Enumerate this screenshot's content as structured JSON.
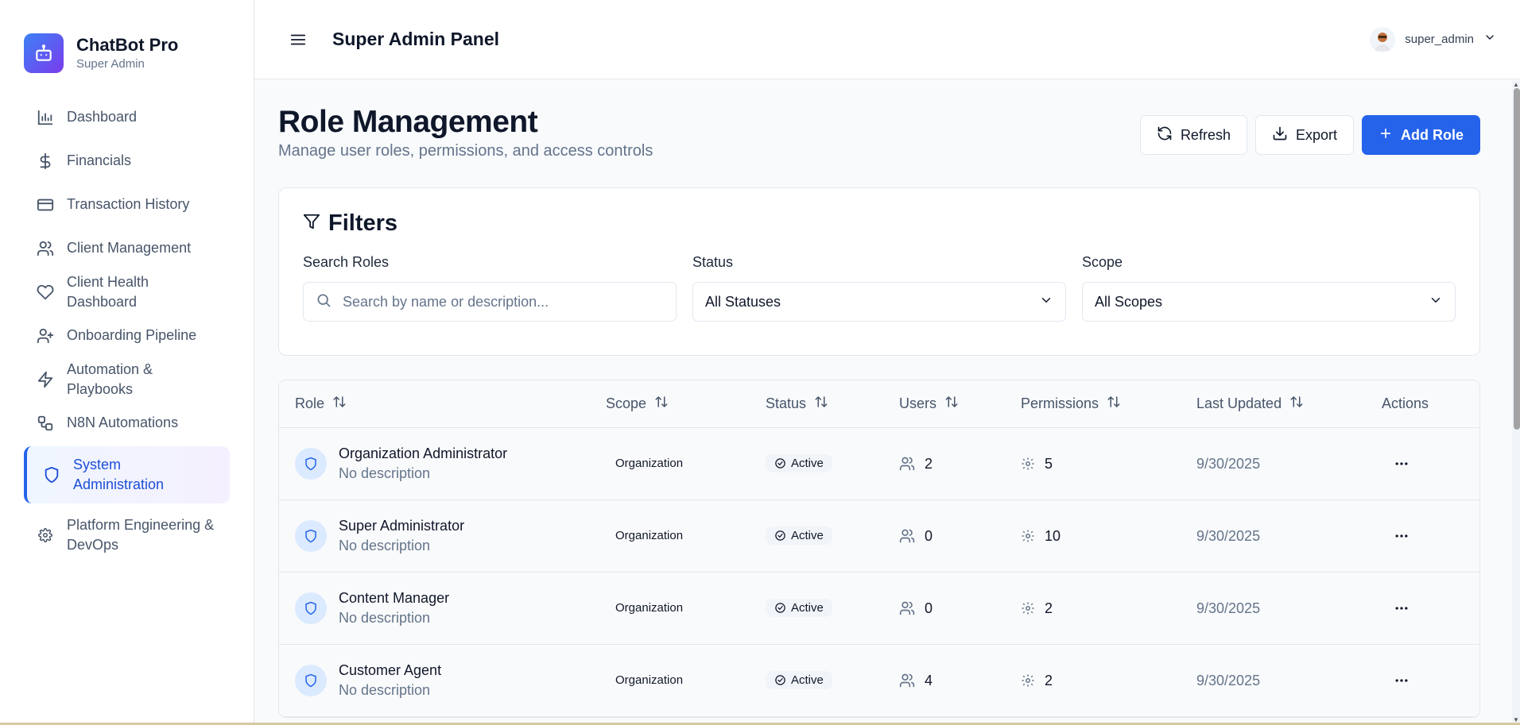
{
  "brand": {
    "name": "ChatBot Pro",
    "subtitle": "Super Admin"
  },
  "sidebar": {
    "items": [
      {
        "label": "Dashboard",
        "icon": "bar-chart-icon"
      },
      {
        "label": "Financials",
        "icon": "dollar-icon"
      },
      {
        "label": "Transaction History",
        "icon": "credit-card-icon"
      },
      {
        "label": "Client Management",
        "icon": "users-icon"
      },
      {
        "label": "Client Health Dashboard",
        "icon": "heart-icon"
      },
      {
        "label": "Onboarding Pipeline",
        "icon": "user-plus-icon"
      },
      {
        "label": "Automation & Playbooks",
        "icon": "lightning-icon"
      },
      {
        "label": "N8N Automations",
        "icon": "workflow-icon"
      },
      {
        "label": "System Administration",
        "icon": "shield-icon",
        "active": true
      },
      {
        "label": "Platform Engineering & DevOps",
        "icon": "gear-icon"
      }
    ]
  },
  "header": {
    "title": "Super Admin Panel",
    "username": "super_admin"
  },
  "page": {
    "title": "Role Management",
    "subtitle": "Manage user roles, permissions, and access controls",
    "refresh_label": "Refresh",
    "export_label": "Export",
    "add_label": "Add Role"
  },
  "filters": {
    "title": "Filters",
    "search_label": "Search Roles",
    "search_placeholder": "Search by name or description...",
    "status_label": "Status",
    "status_value": "All Statuses",
    "scope_label": "Scope",
    "scope_value": "All Scopes"
  },
  "table": {
    "headers": {
      "role": "Role",
      "scope": "Scope",
      "status": "Status",
      "users": "Users",
      "permissions": "Permissions",
      "updated": "Last Updated",
      "actions": "Actions"
    },
    "rows": [
      {
        "name": "Organization Administrator",
        "description": "No description",
        "scope": "Organization",
        "status": "Active",
        "users": "2",
        "permissions": "5",
        "updated": "9/30/2025"
      },
      {
        "name": "Super Administrator",
        "description": "No description",
        "scope": "Organization",
        "status": "Active",
        "users": "0",
        "permissions": "10",
        "updated": "9/30/2025"
      },
      {
        "name": "Content Manager",
        "description": "No description",
        "scope": "Organization",
        "status": "Active",
        "users": "0",
        "permissions": "2",
        "updated": "9/30/2025"
      },
      {
        "name": "Customer Agent",
        "description": "No description",
        "scope": "Organization",
        "status": "Active",
        "users": "4",
        "permissions": "2",
        "updated": "9/30/2025"
      }
    ]
  },
  "colors": {
    "accent": "#2563eb",
    "brand_gradient_start": "#3b82f6",
    "brand_gradient_end": "#7c3aed",
    "text_muted": "#64748b"
  }
}
